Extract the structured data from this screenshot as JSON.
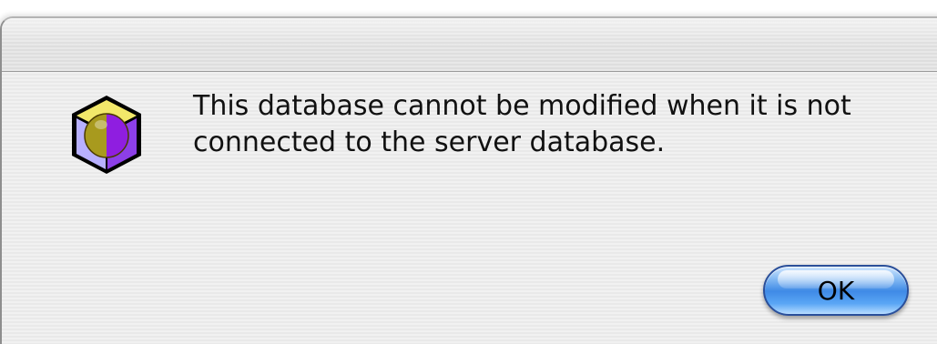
{
  "dialog": {
    "message_lines": [
      "This database cannot be modified when it is not",
      "connected to the server database."
    ],
    "ok_label": "OK",
    "icon": "database-cube-icon"
  },
  "colors": {
    "button_blue": "#3f8ae6",
    "icon_yellow": "#c9b600",
    "icon_purple": "#9b2fe0",
    "icon_lavender": "#a79bff"
  }
}
